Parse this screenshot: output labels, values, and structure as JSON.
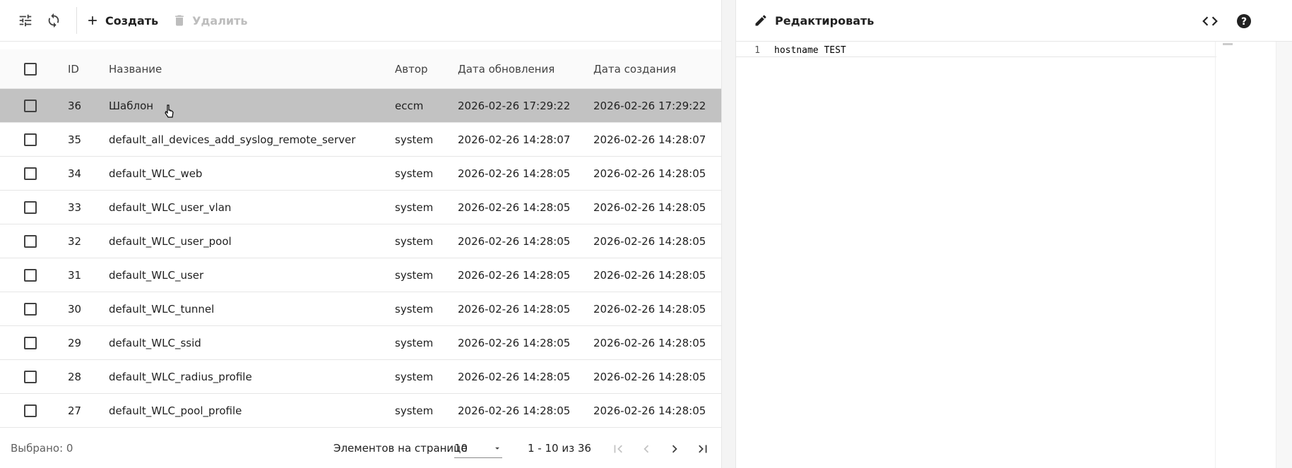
{
  "toolbar": {
    "create_label": "Создать",
    "delete_label": "Удалить"
  },
  "table": {
    "headers": {
      "id": "ID",
      "name": "Название",
      "author": "Автор",
      "updated": "Дата обновления",
      "created": "Дата создания"
    },
    "rows": [
      {
        "id": "36",
        "name": "Шаблон",
        "author": "eccm",
        "updated": "2026-02-26 17:29:22",
        "created": "2026-02-26 17:29:22"
      },
      {
        "id": "35",
        "name": "default_all_devices_add_syslog_remote_server",
        "author": "system",
        "updated": "2026-02-26 14:28:07",
        "created": "2026-02-26 14:28:07"
      },
      {
        "id": "34",
        "name": "default_WLC_web",
        "author": "system",
        "updated": "2026-02-26 14:28:05",
        "created": "2026-02-26 14:28:05"
      },
      {
        "id": "33",
        "name": "default_WLC_user_vlan",
        "author": "system",
        "updated": "2026-02-26 14:28:05",
        "created": "2026-02-26 14:28:05"
      },
      {
        "id": "32",
        "name": "default_WLC_user_pool",
        "author": "system",
        "updated": "2026-02-26 14:28:05",
        "created": "2026-02-26 14:28:05"
      },
      {
        "id": "31",
        "name": "default_WLC_user",
        "author": "system",
        "updated": "2026-02-26 14:28:05",
        "created": "2026-02-26 14:28:05"
      },
      {
        "id": "30",
        "name": "default_WLC_tunnel",
        "author": "system",
        "updated": "2026-02-26 14:28:05",
        "created": "2026-02-26 14:28:05"
      },
      {
        "id": "29",
        "name": "default_WLC_ssid",
        "author": "system",
        "updated": "2026-02-26 14:28:05",
        "created": "2026-02-26 14:28:05"
      },
      {
        "id": "28",
        "name": "default_WLC_radius_profile",
        "author": "system",
        "updated": "2026-02-26 14:28:05",
        "created": "2026-02-26 14:28:05"
      },
      {
        "id": "27",
        "name": "default_WLC_pool_profile",
        "author": "system",
        "updated": "2026-02-26 14:28:05",
        "created": "2026-02-26 14:28:05"
      }
    ]
  },
  "footer": {
    "selected": "Выбрано: 0",
    "page_size_label": "Элементов на странице",
    "page_size_value": "10",
    "range": "1 - 10 из 36"
  },
  "editor": {
    "edit_label": "Редактировать",
    "lines": [
      {
        "num": "1",
        "text": "hostname TEST"
      }
    ]
  },
  "colors": {
    "selected_row": "#c2c2c2",
    "divider": "#f4f4f4",
    "disabled_text": "#bdbdbd"
  },
  "icons": [
    "tune-icon",
    "refresh-icon",
    "plus-icon",
    "trash-icon",
    "pencil-icon",
    "code-icon",
    "help-icon",
    "first-page-icon",
    "prev-page-icon",
    "next-page-icon",
    "last-page-icon",
    "dropdown-arrow-icon",
    "cursor-icon"
  ]
}
